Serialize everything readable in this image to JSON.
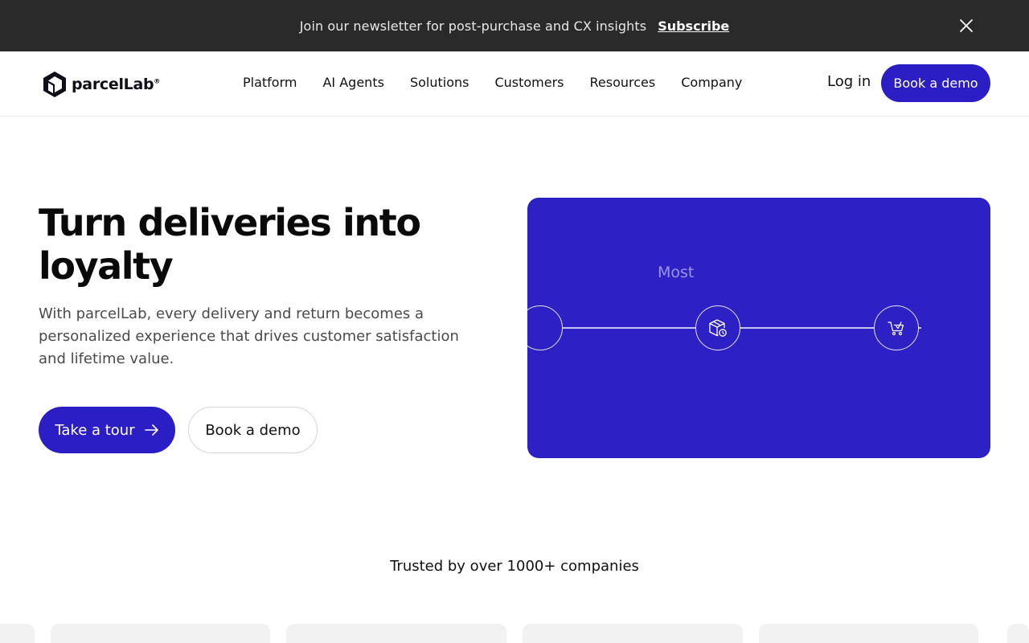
{
  "announcement": {
    "text": "Join our newsletter for post-purchase and CX insights",
    "link_label": "Subscribe",
    "close_icon": "close-icon"
  },
  "header": {
    "brand": "parcelLab",
    "brand_mark": "®",
    "logo_icon": "parcellab-cube-logo-icon",
    "nav": [
      "Platform",
      "AI Agents",
      "Solutions",
      "Customers",
      "Resources",
      "Company"
    ],
    "login_label": "Log in",
    "demo_label": "Book a demo"
  },
  "hero": {
    "title": "Turn deliveries into loyalty",
    "subtitle": "With parcelLab, every delivery and return becomes a personalized experience that drives customer satisfaction and lifetime value.",
    "primary_cta": "Take a tour",
    "primary_cta_icon": "arrow-right-icon",
    "secondary_cta": "Book a demo",
    "card": {
      "word": "Most",
      "nodes": [
        "empty-circle",
        "package-icon",
        "cart-icon"
      ]
    }
  },
  "trusted": {
    "heading": "Trusted by over 1000+ companies"
  },
  "colors": {
    "brand": "#2b1ec4",
    "card_bg": "#2d20c4",
    "topbar_bg": "#2a2a2a"
  }
}
